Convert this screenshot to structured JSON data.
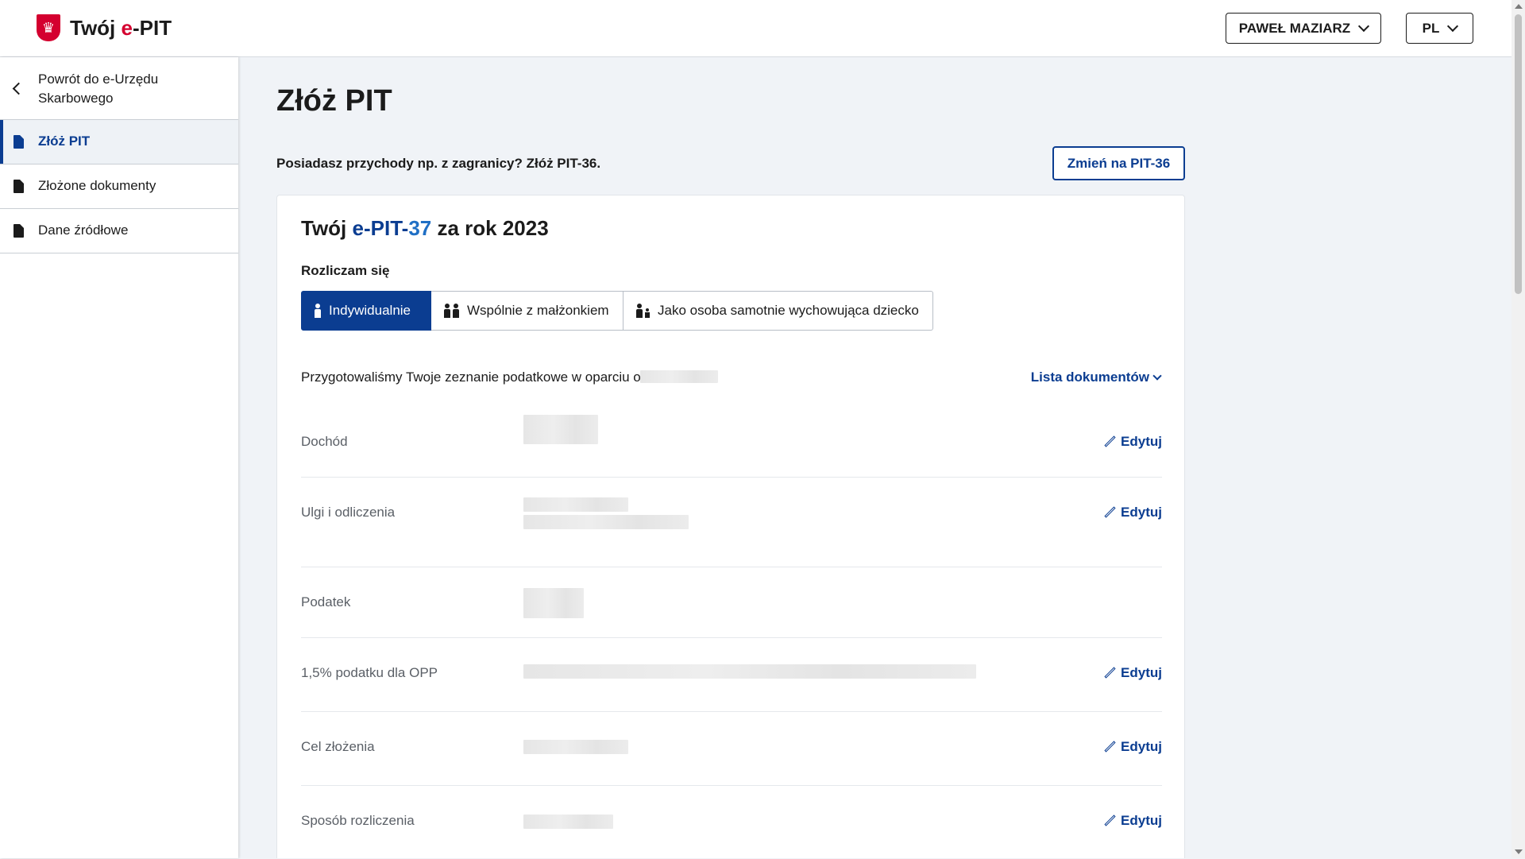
{
  "header": {
    "brand_prefix": "Twój ",
    "brand_accent": "e",
    "brand_suffix": "-PIT",
    "user_label": "PAWEŁ MAZIARZ",
    "lang_label": "PL"
  },
  "sidebar": {
    "back_label": "Powrót do e-Urzędu Skarbowego",
    "items": [
      {
        "label": "Złóż PIT",
        "active": true
      },
      {
        "label": "Złożone dokumenty",
        "active": false
      },
      {
        "label": "Dane źródłowe",
        "active": false
      }
    ]
  },
  "main": {
    "title": "Złóż PIT",
    "promo_text": "Posiadasz przychody np. z zagranicy? Złóż PIT-36.",
    "switch_button": "Zmień na PIT-36",
    "card": {
      "title_prefix": "Twój ",
      "title_form": "e-PIT-",
      "title_num": "37",
      "title_suffix": " za rok 2023",
      "settle_label": "Rozliczam się",
      "options": [
        "Indywidualnie",
        "Wspólnie z małżonkiem",
        "Jako osoba samotnie wychowująca dziecko"
      ],
      "selected_option": "Indywidualnie",
      "prepared_text": "Przygotowaliśmy Twoje zeznanie podatkowe w oparciu o",
      "docs_link": "Lista dokumentów",
      "edit_label": "Edytuj",
      "rows": [
        {
          "label": "Dochód",
          "editable": true
        },
        {
          "label": "Ulgi i odliczenia",
          "editable": true
        },
        {
          "label": "Podatek",
          "editable": false
        },
        {
          "label": "1,5% podatku dla OPP",
          "editable": true
        },
        {
          "label": "Cel złożenia",
          "editable": true
        },
        {
          "label": "Sposób rozliczenia",
          "editable": true
        }
      ]
    }
  },
  "colors": {
    "primary": "#0b3d91",
    "brand_red": "#d4002f"
  }
}
